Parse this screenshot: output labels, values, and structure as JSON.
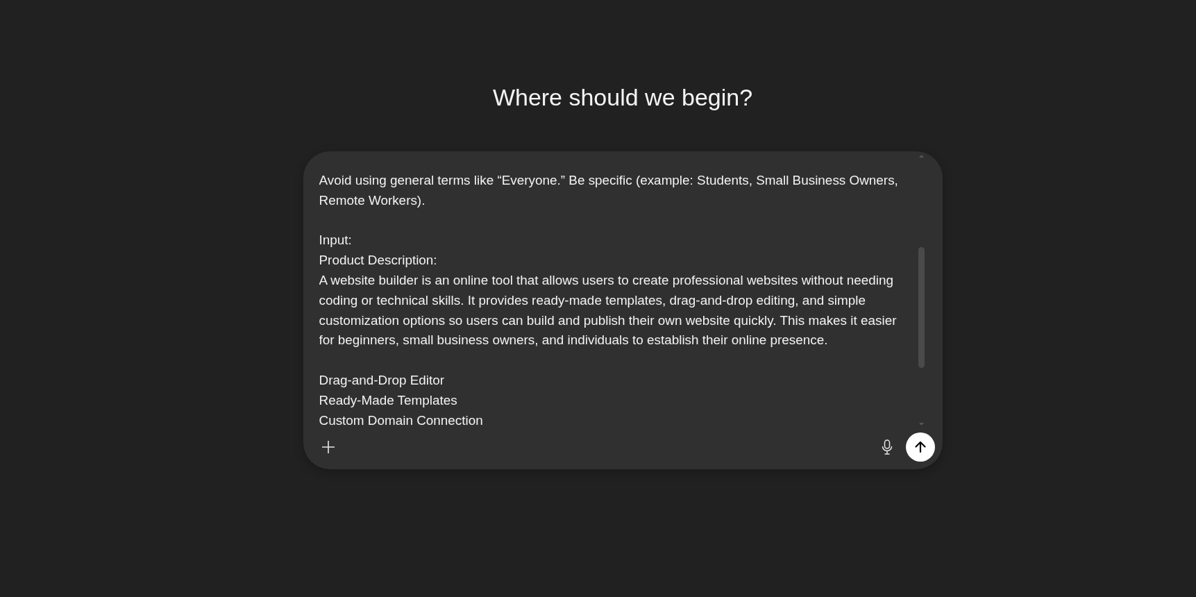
{
  "heading": "Where should we begin?",
  "composer": {
    "message_blocks": [
      [
        "Avoid using general terms like “Everyone.” Be specific (example: Students, Small Business Owners,",
        "Remote Workers)."
      ],
      [
        "Input:",
        "Product Description:",
        "A website builder is an online tool that allows users to create professional websites without needing",
        "coding or technical skills. It provides ready-made templates, drag-and-drop editing, and simple",
        "customization options so users can build and publish their own website quickly. This makes it easier",
        "for beginners, small business owners, and individuals to establish their online presence."
      ],
      [
        "Drag-and-Drop Editor",
        "Ready-Made Templates",
        "Custom Domain Connection"
      ]
    ]
  }
}
